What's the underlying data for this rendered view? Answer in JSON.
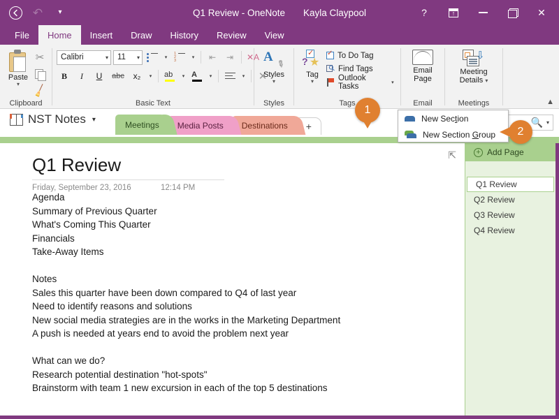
{
  "titlebar": {
    "back_icon": "back-circle-icon",
    "undo_icon": "undo-icon",
    "qat_more_icon": "quick-access-more-icon",
    "document_title": "Q1 Review - OneNote",
    "user_name": "Kayla Claypool",
    "help_label": "?",
    "ribbon_display_icon": "ribbon-display-options-icon",
    "minimize_icon": "minimize-icon",
    "restore_icon": "restore-icon",
    "close_label": "✕"
  },
  "ribbon_tabs": [
    {
      "label": "File",
      "active": false
    },
    {
      "label": "Home",
      "active": true
    },
    {
      "label": "Insert",
      "active": false
    },
    {
      "label": "Draw",
      "active": false
    },
    {
      "label": "History",
      "active": false
    },
    {
      "label": "Review",
      "active": false
    },
    {
      "label": "View",
      "active": false
    }
  ],
  "ribbon": {
    "clipboard": {
      "group_label": "Clipboard",
      "paste_label": "Paste",
      "paste_caret": "▾",
      "cut_icon": "scissors-icon",
      "copy_icon": "copy-icon",
      "format_painter_icon": "format-painter-icon"
    },
    "basic_text": {
      "group_label": "Basic Text",
      "font_name": "Calibri",
      "font_size": "11",
      "caret": "▾",
      "bullets_icon": "bullet-list-icon",
      "numbering_icon": "numbered-list-icon",
      "decrease_indent_icon": "decrease-indent-icon",
      "increase_indent_icon": "increase-indent-icon",
      "clear_formatting_icon": "clear-formatting-icon",
      "bold_label": "B",
      "italic_label": "I",
      "underline_label": "U",
      "strikethrough_label": "abc",
      "subscript_label": "x₂",
      "highlight_icon": "text-highlight-icon",
      "font_color_icon": "font-color-icon",
      "align_icon": "paragraph-alignment-icon",
      "clear_label": "✕"
    },
    "styles": {
      "group_label": "Styles",
      "button_label": "Styles",
      "caret": "▾",
      "icon": "styles-icon"
    },
    "tags": {
      "group_label": "Tags",
      "tag_button_label": "Tag",
      "caret": "▾",
      "tag_icon": "tag-icon",
      "items": [
        {
          "label": "To Do Tag",
          "icon": "checkbox-icon"
        },
        {
          "label": "Find Tags",
          "icon": "find-tags-icon"
        },
        {
          "label": "Outlook Tasks",
          "icon": "flag-icon",
          "caret": "▾"
        }
      ]
    },
    "email": {
      "group_label": "Email",
      "button_label_line1": "Email",
      "button_label_line2": "Page",
      "icon": "envelope-icon"
    },
    "meetings": {
      "group_label": "Meetings",
      "button_label_line1": "Meeting",
      "button_label_line2": "Details",
      "caret": "▾",
      "icon": "meeting-details-icon"
    },
    "collapse_icon": "collapse-ribbon-icon"
  },
  "notebook_bar": {
    "notebook_icon": "notebook-icon",
    "notebook_name": "NST Notes",
    "notebook_caret": "▾",
    "sections": [
      {
        "label": "Meetings",
        "active": true,
        "color": "#a9d08e"
      },
      {
        "label": "Media Posts",
        "active": false,
        "color": "#f0a0c8"
      },
      {
        "label": "Destinations",
        "active": false,
        "color": "#f0a898"
      }
    ],
    "add_section_label": "+",
    "search_icon": "search-icon",
    "search_caret": "▾",
    "search_placeholder": ""
  },
  "dropdown_menu": {
    "items": [
      {
        "label_before": "New Sec",
        "label_underlined": "t",
        "label_after": "ion",
        "icon": "section-tab-icon"
      },
      {
        "label_before": "New Section ",
        "label_underlined": "G",
        "label_after": "roup",
        "icon": "section-group-icon"
      }
    ]
  },
  "page": {
    "expand_icon": "expand-page-icon",
    "title": "Q1 Review",
    "date": "Friday, September 23, 2016",
    "time": "12:14 PM",
    "lines": [
      "Agenda",
      "Summary of Previous Quarter",
      "What's Coming This Quarter",
      "Financials",
      "Take-Away Items",
      "",
      "Notes",
      "Sales this quarter have been down compared to Q4 of last year",
      "Need to identify reasons and solutions",
      "New social media strategies are in the works in the Marketing Department",
      "A push is needed at years end to avoid the problem next year",
      "",
      "What can we do?",
      "Research potential destination \"hot-spots\"",
      "Brainstorm with team 1 new excursion in each of the top 5 destinations"
    ]
  },
  "page_pane": {
    "add_page_label": "Add Page",
    "add_page_icon": "plus-circle-icon",
    "pages": [
      {
        "label": "Q1 Review",
        "selected": true
      },
      {
        "label": "Q2 Review",
        "selected": false
      },
      {
        "label": "Q3 Review",
        "selected": false
      },
      {
        "label": "Q4 Review",
        "selected": false
      }
    ]
  },
  "callouts": [
    {
      "number": "1",
      "kind": "pin"
    },
    {
      "number": "2",
      "kind": "bubble"
    }
  ],
  "colors": {
    "brand_purple": "#803980",
    "section_green": "#a9d08e",
    "pane_green": "#e8f2e0",
    "callout_orange": "#e08030",
    "accent_blue": "#3c6fa8"
  }
}
